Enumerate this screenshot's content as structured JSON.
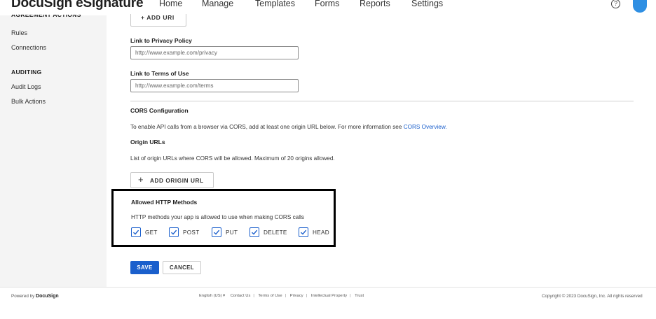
{
  "header": {
    "brand": "DocuSign eSignature",
    "nav": [
      "Home",
      "Manage",
      "Templates",
      "Forms",
      "Reports",
      "Settings"
    ],
    "help_glyph": "?",
    "help_icon": "help-circle-icon",
    "avatar_icon": "user-avatar-icon"
  },
  "sidebar": {
    "section_cut": "AGREEMENT ACTIONS",
    "items_top": [
      "Rules",
      "Connections"
    ],
    "auditing_heading": "AUDITING",
    "items_auditing": [
      "Audit Logs",
      "Bulk Actions"
    ]
  },
  "main": {
    "add_url_label": "+ ADD URI",
    "privacy": {
      "label": "Link to Privacy Policy",
      "placeholder": "http://www.example.com/privacy"
    },
    "terms": {
      "label": "Link to Terms of Use",
      "placeholder": "http://www.example.com/terms"
    },
    "cors": {
      "heading": "CORS Configuration",
      "description": "To enable API calls from a browser via CORS, add at least one origin URL below. For more information see",
      "link": "CORS Overview.",
      "origin_heading": "Origin URLs",
      "origin_description": "List of origin URLs where CORS will be allowed. Maximum of 20 origins allowed.",
      "add_origin_plus": "+",
      "add_origin_label": "ADD ORIGIN URL"
    },
    "http_methods": {
      "heading": "Allowed HTTP Methods",
      "description": "HTTP methods your app is allowed to use when making CORS calls",
      "methods": [
        {
          "label": "GET",
          "checked": true
        },
        {
          "label": "POST",
          "checked": true
        },
        {
          "label": "PUT",
          "checked": true
        },
        {
          "label": "DELETE",
          "checked": true
        },
        {
          "label": "HEAD",
          "checked": true
        }
      ]
    },
    "save_label": "SAVE",
    "cancel_label": "CANCEL"
  },
  "footer": {
    "powered_by": "Powered by",
    "powered_brand": "DocuSign",
    "language": "English (US) ▾",
    "links": [
      "Contact Us",
      "Terms of Use",
      "Privacy",
      "Intellectual Property",
      "Trust"
    ],
    "copyright": "Copyright © 2023 DocuSign, Inc. All rights reserved"
  },
  "colors": {
    "accent": "#1a5fcc",
    "sidebar_bg": "#f4f4f4",
    "avatar": "#2f8fe3"
  }
}
